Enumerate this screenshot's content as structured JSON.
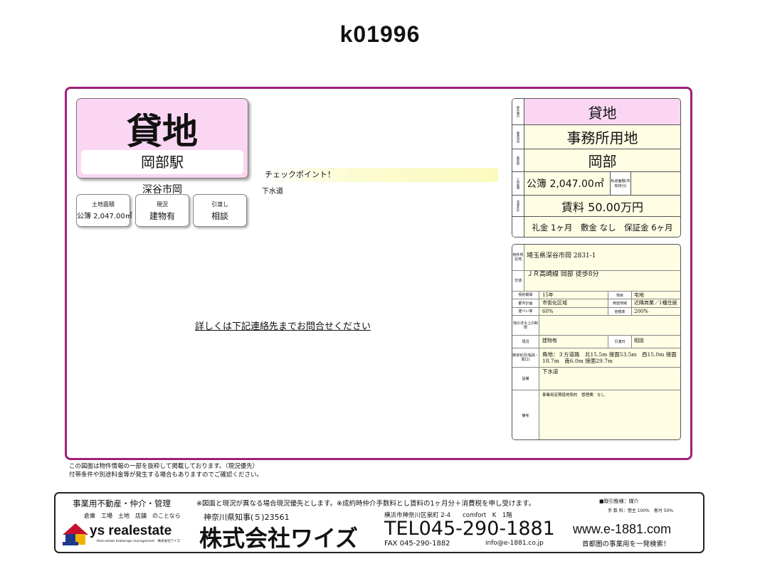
{
  "title": "k01996",
  "card": {
    "type": "貸地",
    "station": "岡部駅",
    "city": "深谷市岡"
  },
  "mini": [
    {
      "label": "土地面積",
      "value": "公簿 2,047.00㎡"
    },
    {
      "label": "現況",
      "value": "建物有"
    },
    {
      "label": "引渡し",
      "value": "相談"
    }
  ],
  "checkpoint": {
    "title": "チェックポイント！",
    "text": "下水道"
  },
  "contact_link": "詳しくは下記連絡先までお問合せください",
  "summary": {
    "type": "貸地",
    "use": "事務所用地",
    "station": "岡部",
    "land_area": "公簿 2,047.00㎡",
    "private_road": "私道面積(共有持分)",
    "rent": "賃料 50.00万円",
    "terms": "礼金 1ヶ月　敷金 なし　保証金 6ヶ月",
    "side_labels": [
      "物件種目",
      "最適用途",
      "最寄駅",
      "土地面積",
      "賃貸条件"
    ]
  },
  "detail": {
    "address_label": "物件所在地",
    "address": "埼玉県深谷市岡 2831-1",
    "traffic_label": "交通",
    "traffic": "ＪＲ高崎線 岡部 徒歩8分",
    "term_label": "契約期間",
    "term": "15年",
    "chimoku_label": "地目",
    "chimoku": "宅地",
    "plan_label": "都市計画",
    "plan": "市街化区域",
    "zone_label": "用途地域",
    "zone": "近隣商業／1種住居",
    "bcr_label": "建ぺい率",
    "bcr": "60%",
    "far_label": "容積率",
    "far": "200%",
    "law_label": "他の法令上の制限",
    "current_label": "現況",
    "current": "建物有",
    "handover_label": "引渡日",
    "handover": "相談",
    "road_label": "接道状況(幅員・間口)",
    "road": "角地：３方道路　北15.5m 接面53.5m　西15.0m 接面18.7m　南6.0m 接面29.7m",
    "facility_label": "設備",
    "facility": "下水道",
    "remarks_label": "備考",
    "remarks": "事業用定期借地契約　管理費：なし"
  },
  "notes": [
    "この図面は物件情報の一部を抜粋して掲載しております。（現況優先）",
    "付帯条件や別途料金等が発生する場合もありますのでご確認ください。"
  ],
  "footer": {
    "business": "事業用不動産・仲介・管理",
    "business_sub": "倉庫　工場　土地　店舗　のことなら",
    "logo_text": "ys realestate",
    "logo_sub": "Real estate brokerage management　株式会社ワイズ",
    "notice": "※図面と現況が異なる場合現況優先とします。※成約時仲介手数料とし賃料の1ヶ月分＋消費税を申し受けます。",
    "license": "神奈川県知事(５)23561",
    "company": "株式会社ワイズ",
    "address": "横浜市神奈川区泉町 2-4　　comfort　K　1階",
    "tel": "TEL045-290-1881",
    "fax": "FAX 045-290-1882",
    "email": "info@e-1881.co.jp",
    "deal": "■取引態様：媒介",
    "fee": "手 数 料：借主 100%　客付 50%",
    "web": "www.e-1881.com",
    "web_sub": "首都圏の事業用を一発検索！"
  },
  "colors": {
    "frame": "#a0207a",
    "card_bg": "#fbd6f3",
    "table_bg": "#fffde4",
    "checkpoint": "#fbfbc0"
  }
}
